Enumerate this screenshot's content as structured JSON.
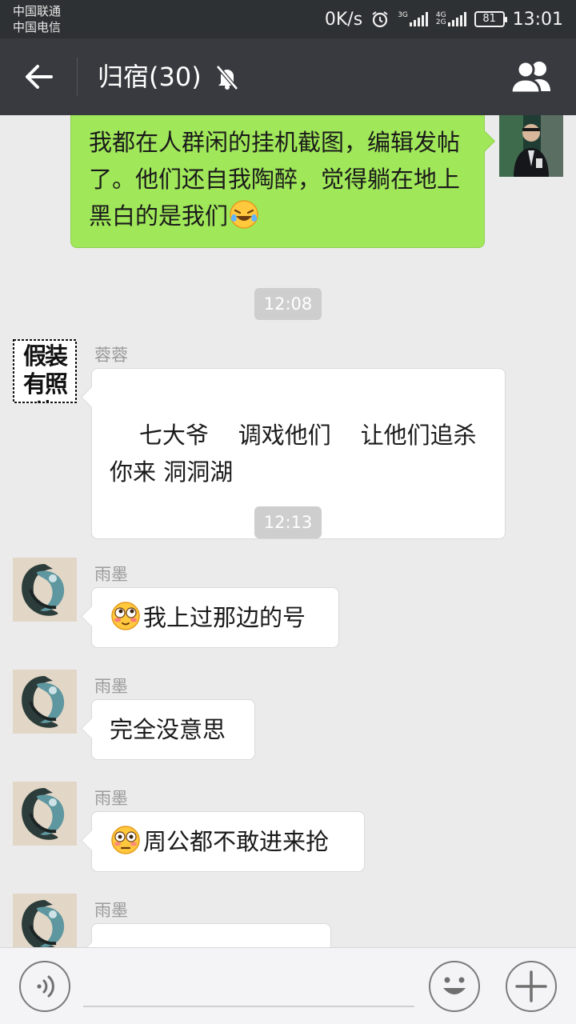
{
  "status_bar": {
    "carrier_1": "中国联通",
    "carrier_2": "中国电信",
    "network_speed": "0K/s",
    "net_3g": "3G",
    "net_4g": "4G",
    "net_2g": "2G",
    "battery": "81",
    "time": "13:01"
  },
  "header": {
    "title": "归宿(30)",
    "back_icon": "arrow-left-icon",
    "mute_icon": "bell-off-icon",
    "group_icon": "group-members-icon"
  },
  "messages": [
    {
      "side": "right",
      "text": "我都在人群闲的挂机截图，编辑发帖了。他们还自我陶醉，觉得躺在地上黑白的是我们",
      "emoji": "laugh-cry-emoji"
    },
    {
      "timestamp": "12:08"
    },
    {
      "side": "left",
      "sender": "蓉蓉",
      "avatar_text": "假装有照片",
      "text": "七大爷    调戏他们    让他们追杀你来 洞洞湖"
    },
    {
      "timestamp": "12:13"
    },
    {
      "side": "left",
      "sender": "雨墨",
      "text": "我上过那边的号",
      "emoji": "blush-emoji"
    },
    {
      "side": "left",
      "sender": "雨墨",
      "text": "完全没意思"
    },
    {
      "side": "left",
      "sender": "雨墨",
      "text": "周公都不敢进来抢",
      "emoji": "flushed-emoji"
    },
    {
      "side": "left",
      "sender": "雨墨",
      "text": ""
    }
  ],
  "input_bar": {
    "voice_icon": "voice-icon",
    "emoji_icon": "smiley-icon",
    "plus_icon": "plus-icon",
    "placeholder": ""
  },
  "colors": {
    "header_bg": "#393a3f",
    "status_bg": "#2e3133",
    "chat_bg": "#ebebeb",
    "self_bubble": "#a0e75a",
    "other_bubble": "#ffffff"
  }
}
